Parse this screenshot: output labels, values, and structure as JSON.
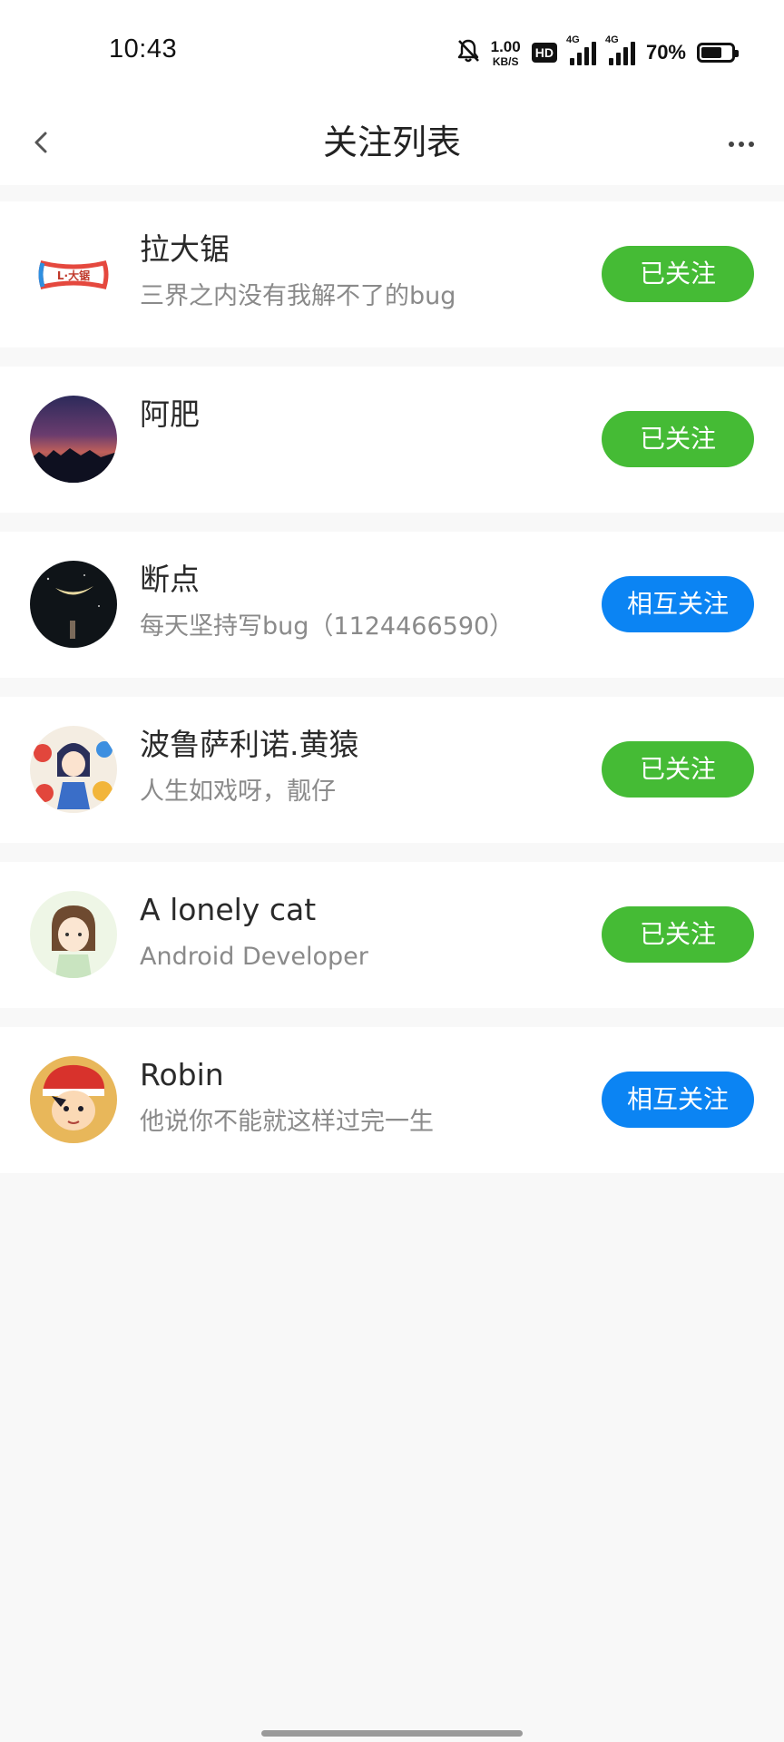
{
  "status_bar": {
    "time": "10:43",
    "net_speed_value": "1.00",
    "net_speed_unit": "KB/S",
    "hd_label": "HD",
    "signal1_label": "4G",
    "signal2_label": "4G",
    "battery_percent": "70%",
    "battery_level": 0.7
  },
  "header": {
    "title": "关注列表",
    "back_icon": "chevron-left-icon",
    "more_icon": "more-horizontal-icon"
  },
  "colors": {
    "followed_green": "#45bb35",
    "mutual_blue": "#0b84f3"
  },
  "follow_list": [
    {
      "name": "拉大锯",
      "desc": "三界之内没有我解不了的bug",
      "button": "已关注",
      "logo_text": "L·大锯"
    },
    {
      "name": "阿肥",
      "desc": "",
      "button": "已关注"
    },
    {
      "name": "断点",
      "desc": "每天坚持写bug（1124466590）",
      "button": "相互关注"
    },
    {
      "name": "波鲁萨利诺.黄猿",
      "desc": "人生如戏呀，靓仔",
      "button": "已关注"
    },
    {
      "name": "A lonely cat",
      "desc": "Android Developer",
      "button": "已关注"
    },
    {
      "name": "Robin",
      "desc": "他说你不能就这样过完一生",
      "button": "相互关注"
    }
  ]
}
